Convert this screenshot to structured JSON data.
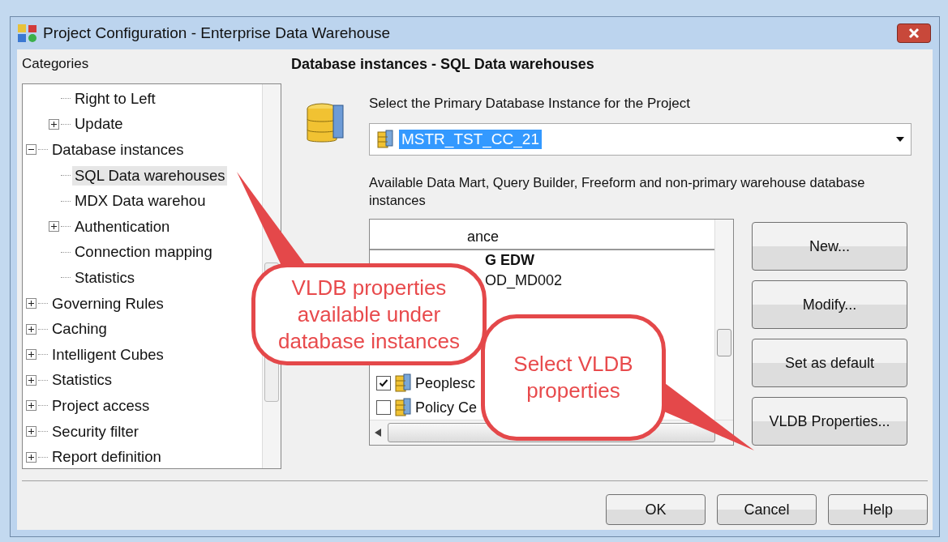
{
  "window": {
    "title": "Project Configuration - Enterprise Data Warehouse"
  },
  "categories": {
    "label": "Categories",
    "items": [
      {
        "kind": "hidden",
        "children": [
          {
            "label": "Right to Left",
            "kind": "leaf",
            "selected": false
          },
          {
            "label": "Update",
            "kind": "branch",
            "expanded": false,
            "selected": false
          }
        ]
      },
      {
        "label": "Database instances",
        "kind": "branch",
        "expanded": true,
        "selected": false,
        "children": [
          {
            "label": "SQL Data warehouses",
            "kind": "leaf",
            "selected": true
          },
          {
            "label": "MDX Data warehou",
            "kind": "leaf",
            "selected": false
          },
          {
            "label": "Authentication",
            "kind": "branch",
            "expanded": false,
            "selected": false
          },
          {
            "label": "Connection mapping",
            "kind": "leaf",
            "selected": false
          },
          {
            "label": "Statistics",
            "kind": "leaf",
            "selected": false
          }
        ]
      },
      {
        "label": "Governing Rules",
        "kind": "branch",
        "expanded": false,
        "selected": false
      },
      {
        "label": "Caching",
        "kind": "branch",
        "expanded": false,
        "selected": false
      },
      {
        "label": "Intelligent Cubes",
        "kind": "branch",
        "expanded": false,
        "selected": false
      },
      {
        "label": "Statistics",
        "kind": "branch",
        "expanded": false,
        "selected": false
      },
      {
        "label": "Project access",
        "kind": "branch",
        "expanded": false,
        "selected": false
      },
      {
        "label": "Security filter",
        "kind": "branch",
        "expanded": false,
        "selected": false
      },
      {
        "label": "Report definition",
        "kind": "branch",
        "expanded": false,
        "selected": false
      }
    ]
  },
  "panel": {
    "heading": "Database instances - SQL Data warehouses",
    "primary_label": "Select the Primary Database Instance for the Project",
    "primary_value": "MSTR_TST_CC_21",
    "available_label": "Available Data Mart, Query Builder, Freeform and non-primary warehouse database instances",
    "list": {
      "column_1": "ance",
      "rows": [
        {
          "kind": "partial",
          "label": "G EDW",
          "default": true
        },
        {
          "kind": "partial",
          "label": "OD_MD002",
          "default": false
        },
        {
          "kind": "item",
          "label": "Peoplesc",
          "checked": true,
          "default": false
        },
        {
          "kind": "item",
          "label": "Policy Ce",
          "checked": false,
          "default": false
        }
      ]
    },
    "buttons": [
      "New...",
      "Modify...",
      "Set as default",
      "VLDB Properties..."
    ]
  },
  "footer_buttons": [
    "OK",
    "Cancel",
    "Help"
  ],
  "callouts": [
    {
      "text": "VLDB properties available under database instances"
    },
    {
      "text": "Select VLDB properties"
    }
  ]
}
